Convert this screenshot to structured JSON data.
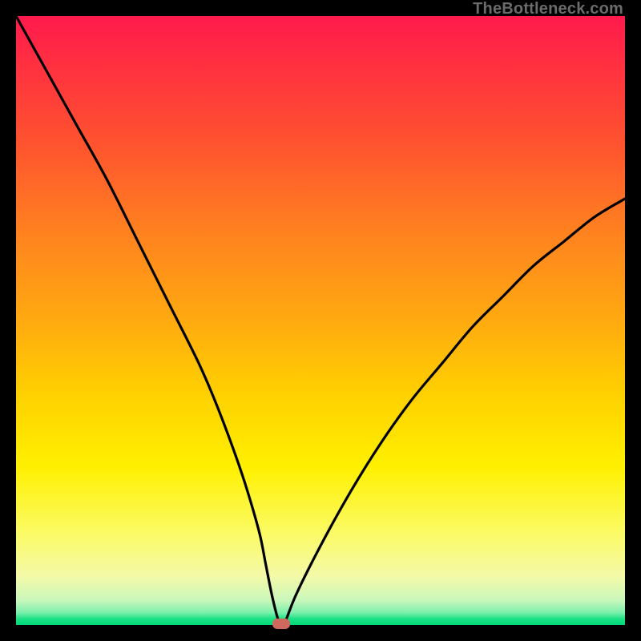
{
  "watermark": "TheBottleneck.com",
  "colors": {
    "frame": "#000000",
    "curve": "#000000",
    "marker": "#cf695d"
  },
  "chart_data": {
    "type": "line",
    "title": "",
    "xlabel": "",
    "ylabel": "",
    "xlim": [
      0,
      100
    ],
    "ylim": [
      0,
      100
    ],
    "grid": false,
    "series": [
      {
        "name": "bottleneck-curve",
        "x": [
          0,
          5,
          10,
          15,
          20,
          25,
          30,
          33,
          36,
          38,
          40,
          41,
          42,
          43,
          43.5,
          44,
          46,
          50,
          55,
          60,
          65,
          70,
          75,
          80,
          85,
          90,
          95,
          100
        ],
        "values": [
          100,
          91,
          82,
          73,
          63,
          53,
          43,
          36,
          28,
          22,
          15,
          10,
          5,
          1,
          0,
          0,
          5,
          13,
          22,
          30,
          37,
          43,
          49,
          54,
          59,
          63,
          67,
          70
        ]
      }
    ],
    "annotations": [
      {
        "name": "min-marker",
        "x": 43.5,
        "y": 0
      }
    ]
  }
}
